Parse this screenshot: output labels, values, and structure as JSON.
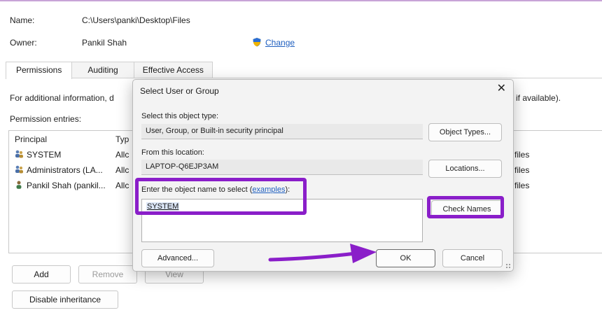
{
  "header": {
    "name_label": "Name:",
    "name_value": "C:\\Users\\panki\\Desktop\\Files",
    "owner_label": "Owner:",
    "owner_value": "Pankil Shah",
    "change_link": "Change"
  },
  "tabs": [
    {
      "label": "Permissions",
      "active": true
    },
    {
      "label": "Auditing",
      "active": false
    },
    {
      "label": "Effective Access",
      "active": false
    }
  ],
  "info_text_left": "For additional information, d",
  "info_text_right": "if available).",
  "permission_entries_label": "Permission entries:",
  "list": {
    "col_principal": "Principal",
    "col_type": "Typ",
    "rows": [
      {
        "principal": "SYSTEM",
        "type": "Allc",
        "applies": "files"
      },
      {
        "principal": "Administrators (LA...",
        "type": "Allc",
        "applies": "files"
      },
      {
        "principal": "Pankil Shah (pankil...",
        "type": "Allc",
        "applies": "files"
      }
    ]
  },
  "buttons": {
    "add": "Add",
    "remove": "Remove",
    "view": "View",
    "disable_inheritance": "Disable inheritance"
  },
  "dialog": {
    "title": "Select User or Group",
    "close": "✕",
    "object_type_label": "Select this object type:",
    "object_type_value": "User, Group, or Built-in security principal",
    "object_types_button": "Object Types...",
    "location_label": "From this location:",
    "location_value": "LAPTOP-Q6EJP3AM",
    "locations_button": "Locations...",
    "enter_label_prefix": "Enter the object name to select (",
    "enter_label_link": "examples",
    "enter_label_suffix": "):",
    "object_name_value": "SYSTEM",
    "check_names_button": "Check Names",
    "advanced_button": "Advanced...",
    "ok_button": "OK",
    "cancel_button": "Cancel"
  },
  "colors": {
    "highlight": "#8a1ec9",
    "link": "#1f5fbf"
  }
}
